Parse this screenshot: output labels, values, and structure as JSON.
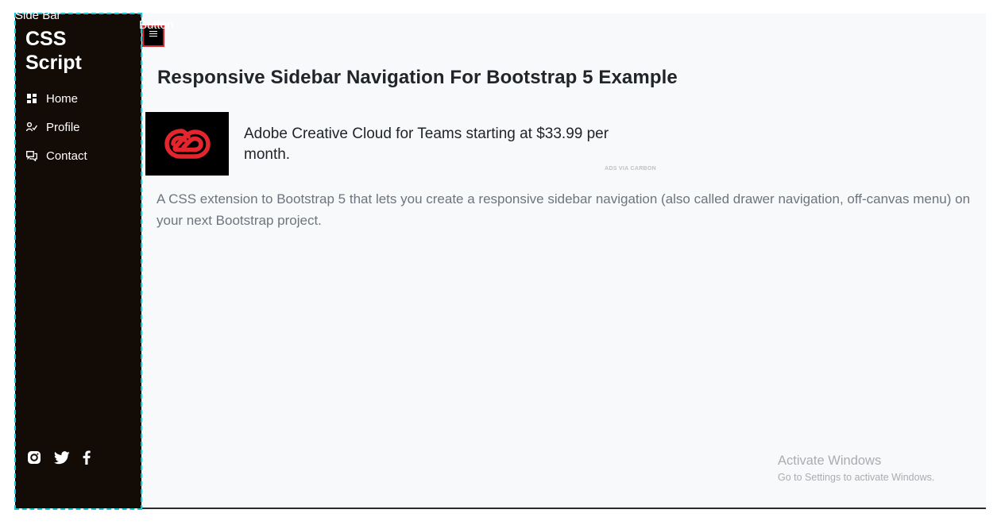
{
  "annotations": {
    "sidebar_label": "Side Bar",
    "button_label": "Button"
  },
  "sidebar": {
    "brand": "CSS Script",
    "items": [
      {
        "label": "Home",
        "icon": "dashboard-icon"
      },
      {
        "label": "Profile",
        "icon": "person-icon"
      },
      {
        "label": "Contact",
        "icon": "chat-icon"
      }
    ],
    "social": [
      {
        "icon": "instagram-icon"
      },
      {
        "icon": "twitter-icon"
      },
      {
        "icon": "facebook-icon"
      }
    ]
  },
  "main": {
    "title": "Responsive Sidebar Navigation For Bootstrap 5 Example",
    "ad": {
      "text": "Adobe Creative Cloud for Teams starting at $33.99 per month.",
      "via": "ADS VIA CARBON",
      "logo_icon": "adobe-creative-cloud-icon"
    },
    "description": "A CSS extension to Bootstrap 5 that lets you create a responsive sidebar navigation (also called drawer navigation, off-canvas menu) on your next Bootstrap project."
  },
  "windows_watermark": {
    "title": "Activate Windows",
    "subtitle": "Go to Settings to activate Windows."
  },
  "colors": {
    "sidebar_bg": "#130b06",
    "main_bg": "#f8f9fa",
    "annotation_sidebar": "#19c6d6",
    "annotation_button": "#d6242a",
    "adobe_red": "#e3262d"
  }
}
